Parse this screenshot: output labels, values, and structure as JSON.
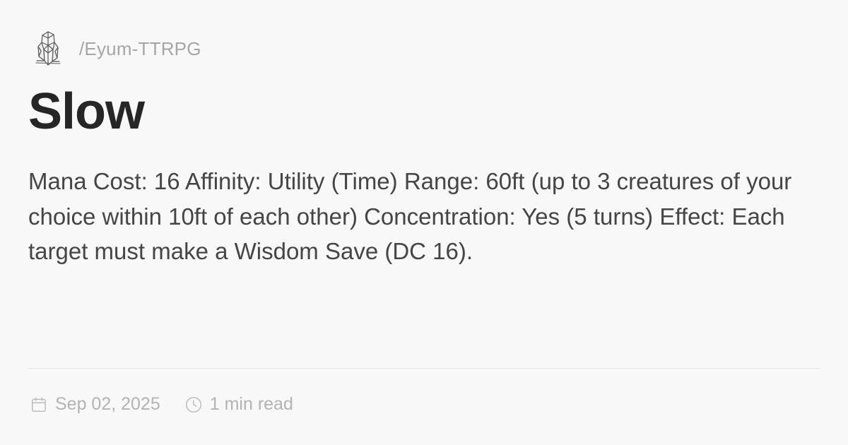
{
  "header": {
    "logo_icon": "crystal-icon",
    "site_name": "/Eyum-TTRPG"
  },
  "article": {
    "title": "Slow",
    "description": "Mana Cost: 16 Affinity: Utility (Time) Range: 60ft (up to 3 creatures of your choice within 10ft of each other) Concentration: Yes (5 turns) Effect: Each target must make a Wisdom Save (DC 16)."
  },
  "meta": {
    "date_icon": "calendar-icon",
    "date": "Sep 02, 2025",
    "read_time_icon": "clock-icon",
    "read_time": "1 min read"
  },
  "colors": {
    "background": "#f9f8f8",
    "title": "#262626",
    "body_text": "#454545",
    "muted_text": "#b3b3b3"
  }
}
